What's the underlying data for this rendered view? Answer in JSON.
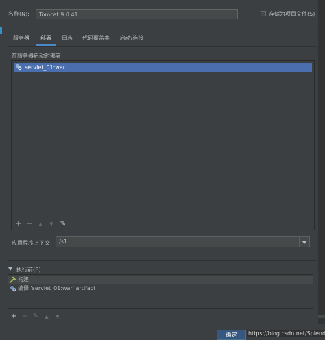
{
  "name_field": {
    "label": "名称(N):",
    "value": "Tomcat 9.0.41"
  },
  "store_as_project_file": {
    "label": "存储为项目文件(S)",
    "checked": false
  },
  "tabs": [
    {
      "label": "服务器",
      "active": false
    },
    {
      "label": "部署",
      "active": true
    },
    {
      "label": "日志",
      "active": false
    },
    {
      "label": "代码覆盖率",
      "active": false
    },
    {
      "label": "启动/连接",
      "active": false
    }
  ],
  "deployment": {
    "group_label": "在服务器启动时部署",
    "items": [
      {
        "label": "servlet_01:war",
        "icon": "artifact-icon",
        "selected": true
      }
    ],
    "toolbar": [
      {
        "name": "add-button",
        "glyph": "+",
        "enabled": true
      },
      {
        "name": "remove-button",
        "glyph": "−",
        "enabled": true
      },
      {
        "name": "move-up-button",
        "glyph": "▲",
        "enabled": false
      },
      {
        "name": "move-down-button",
        "glyph": "▼",
        "enabled": false
      },
      {
        "name": "edit-button",
        "glyph": "✎",
        "enabled": true
      }
    ]
  },
  "app_context": {
    "label": "应用程序上下文:",
    "value": "/s1"
  },
  "before_launch": {
    "title": "执行前(B)",
    "items": [
      {
        "label": "构建",
        "icon": "hammer-icon",
        "selected": true
      },
      {
        "label": "编译 'servlet_01:war' artifact",
        "icon": "artifact-icon",
        "selected": false
      }
    ],
    "toolbar": [
      {
        "name": "add-task-button",
        "glyph": "+",
        "enabled": true
      },
      {
        "name": "remove-task-button",
        "glyph": "−",
        "enabled": false
      },
      {
        "name": "edit-task-button",
        "glyph": "✎",
        "enabled": false
      },
      {
        "name": "move-task-up-button",
        "glyph": "▲",
        "enabled": false
      },
      {
        "name": "move-task-down-button",
        "glyph": "▼",
        "enabled": false
      }
    ]
  },
  "buttons": {
    "ok": "确定"
  },
  "watermark": "https://blog.csdn.net/SplendidJoe",
  "colors": {
    "background": "#3c3f41",
    "selection": "#4b6eaf",
    "accent": "#4a88c7",
    "ok_button": "#365880"
  }
}
